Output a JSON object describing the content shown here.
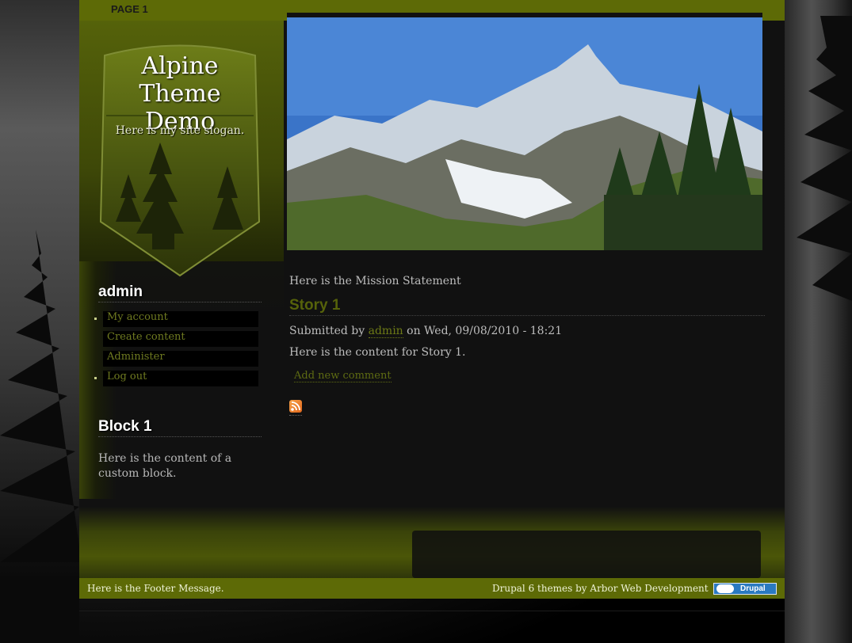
{
  "header": {
    "tab_label": "PAGE 1"
  },
  "site": {
    "name_line1": "Alpine Theme",
    "name_line2": "Demo",
    "slogan": "Here is my site slogan."
  },
  "user_block": {
    "title": "admin",
    "items": [
      {
        "label": "My account"
      },
      {
        "label": "Create content"
      },
      {
        "label": "Administer"
      },
      {
        "label": "Log out"
      }
    ]
  },
  "custom_block": {
    "title": "Block 1",
    "text": "Here is the content of a custom block."
  },
  "main": {
    "mission": "Here is the Mission Statement",
    "story": {
      "title": "Story 1",
      "submitted_prefix": "Submitted by",
      "author": "admin",
      "submitted_suffix": "on Wed, 09/08/2010 - 18:21",
      "body": "Here is the content for Story 1.",
      "comment_link": "Add new comment"
    },
    "feed_icon": "rss-icon"
  },
  "footer": {
    "message": "Here is the Footer Message.",
    "credit": "Drupal 6 themes by Arbor Web Development",
    "badge_label": "Drupal"
  },
  "colors": {
    "accent": "#5d6a06",
    "link": "#6d7a16",
    "text": "#bdbdbd",
    "background": "#111111"
  }
}
